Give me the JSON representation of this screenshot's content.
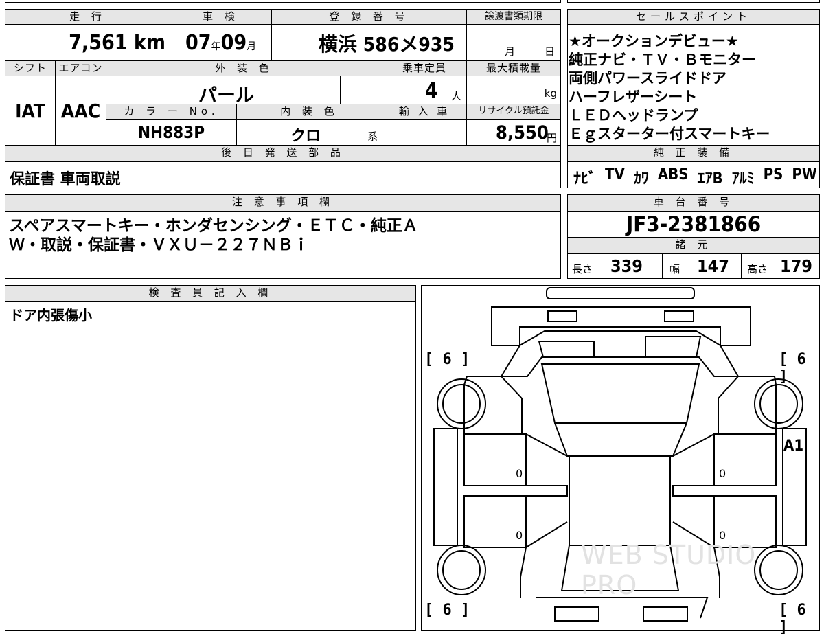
{
  "vehicle": {
    "mileage_header": "走 行",
    "mileage_value": "7,561",
    "mileage_unit": "km",
    "inspection_header": "車 検",
    "inspection_year": "07",
    "inspection_year_unit": "年",
    "inspection_month": "09",
    "inspection_month_unit": "月",
    "registration_header": "登 録 番 号",
    "registration_value": "横浜 586メ935",
    "transfer_header": "譲渡書類期限",
    "transfer_month_unit": "月",
    "transfer_day_unit": "日",
    "shift_header": "シフト",
    "shift_value": "IAT",
    "ac_header": "エアコン",
    "ac_value": "AAC",
    "exterior_color_header": "外 装 色",
    "exterior_color_value": "パール",
    "capacity_header": "乗車定員",
    "capacity_value": "4",
    "capacity_unit": "人",
    "max_load_header": "最大積載量",
    "max_load_unit": "kg",
    "color_no_header": "カ ラ ー No.",
    "color_no_value": "NH883P",
    "interior_color_header": "内 装 色",
    "interior_color_value": "クロ",
    "interior_color_suffix": "系",
    "import_header": "輸 入 車",
    "recycle_header": "リサイクル預託金",
    "recycle_value": "8,550",
    "recycle_unit": "円"
  },
  "sales_points": {
    "header": "セールスポイント",
    "lines": [
      "★オークションデビュー★",
      "純正ナビ・ＴＶ・Ｂモニター",
      "両側パワースライドドア",
      "ハーフレザーシート",
      "ＬＥＤヘッドランプ",
      "Ｅｇスターター付スマートキー"
    ]
  },
  "later_parts": {
    "header": "後 日 発 送 部 品",
    "value": "保証書 車両取説"
  },
  "genuine_equipment": {
    "header": "純 正 装 備",
    "items": [
      "ﾅﾋﾞ",
      "TV",
      "ｶﾜ",
      "ABS",
      "ｴｱB",
      "ｱﾙﾐ",
      "PS",
      "PW"
    ]
  },
  "notes": {
    "header": "注 意 事 項 欄",
    "lines": [
      "スペアスマートキー・ホンダセンシング・ＥＴＣ・純正Ａ",
      "Ｗ・取説・保証書・ＶＸＵ－２２７ＮＢｉ"
    ]
  },
  "chassis": {
    "header": "車 台 番 号",
    "value": "JF3-2381866"
  },
  "specs": {
    "header": "諸 元",
    "length_label": "長さ",
    "length_value": "339",
    "width_label": "幅",
    "width_value": "147",
    "height_label": "高さ",
    "height_value": "179"
  },
  "inspector": {
    "header": "検 査 員 記 入 欄",
    "text": "ドア内張傷小"
  },
  "diagram": {
    "tire_front_left": "[ 6 ]",
    "tire_front_right": "[ 6 ]",
    "tire_rear_left": "[ 6 ]",
    "tire_rear_right": "[ 6 ]",
    "damage_mark": "A1",
    "door_marks": [
      "0",
      "0",
      "0",
      "0"
    ],
    "watermark": "WEB STUDIO PRO"
  }
}
